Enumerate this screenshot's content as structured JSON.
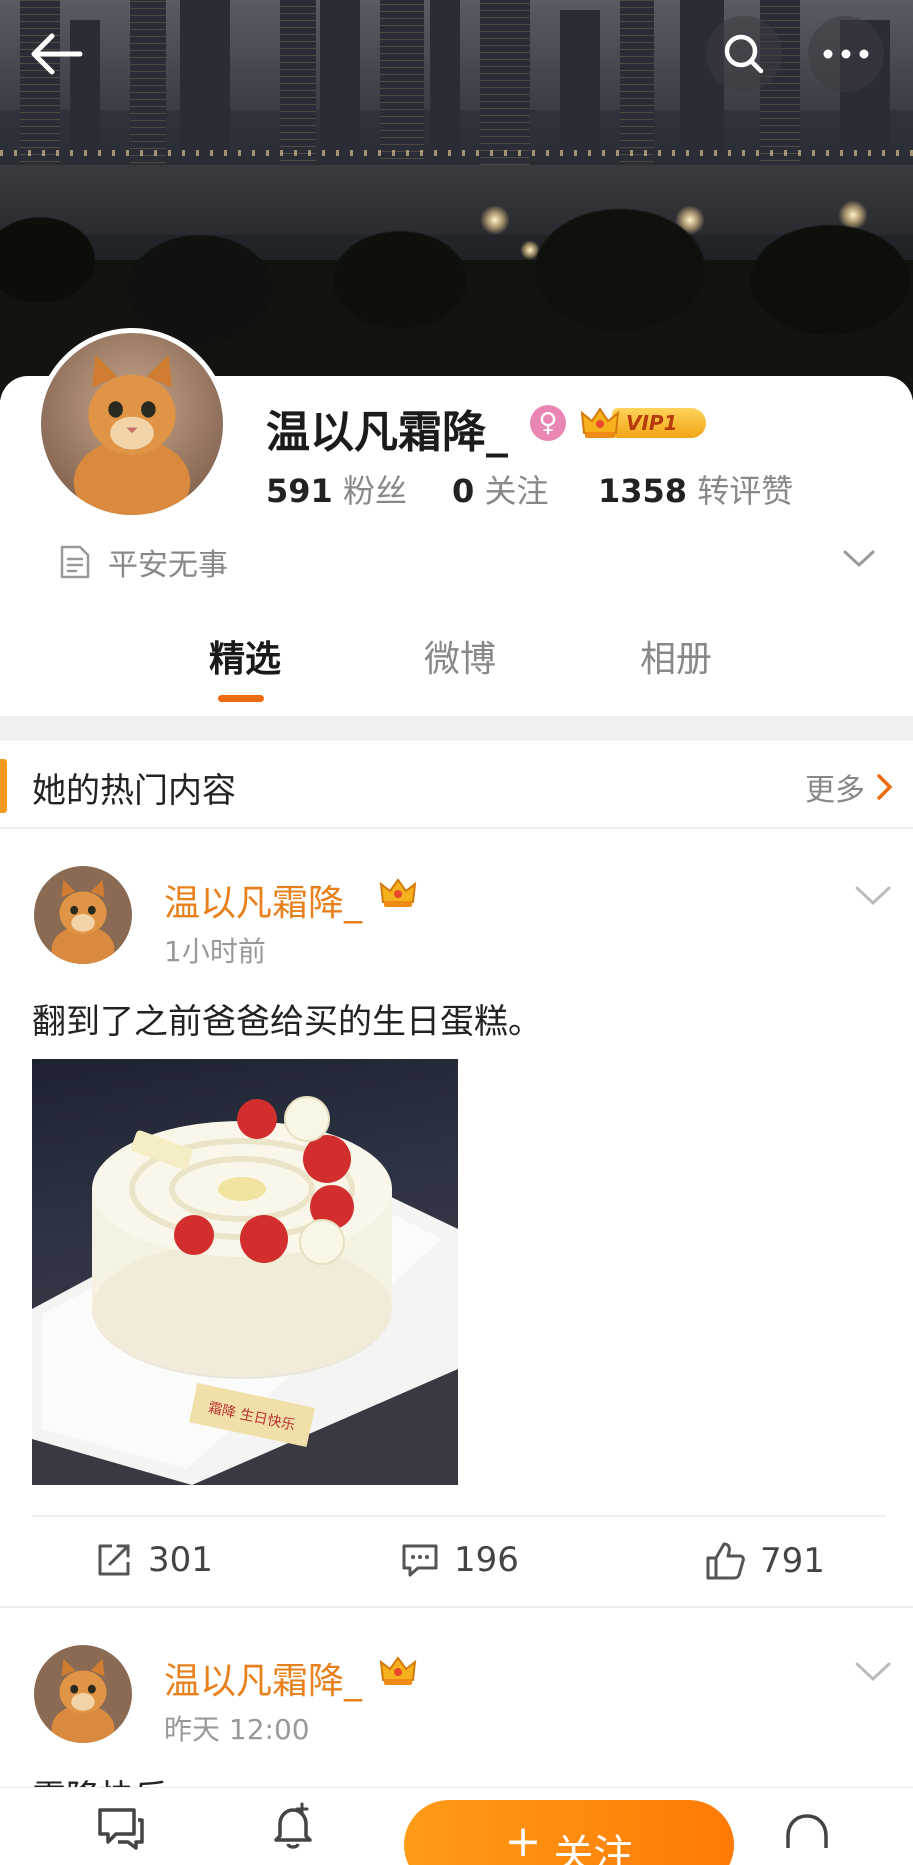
{
  "profile": {
    "name": "温以凡霜降_",
    "gender_symbol": "♀",
    "vip_label": "VIP1",
    "stats": [
      {
        "value": "591",
        "label": "粉丝"
      },
      {
        "value": "0",
        "label": "关注"
      },
      {
        "value": "1358",
        "label": "转评赞"
      }
    ],
    "bio": "平安无事"
  },
  "tabs": [
    {
      "label": "精选",
      "active": true
    },
    {
      "label": "微博",
      "active": false
    },
    {
      "label": "相册",
      "active": false
    }
  ],
  "hot_section": {
    "title": "她的热门内容",
    "more_label": "更多"
  },
  "posts": [
    {
      "author": "温以凡霜降_",
      "time": "1小时前",
      "text": "翻到了之前爸爸给买的生日蛋糕。",
      "cake_card_text": "霜降  生日快乐",
      "reposts": "301",
      "comments": "196",
      "likes": "791"
    },
    {
      "author": "温以凡霜降_",
      "time": "昨天 12:00",
      "text": "霜降快乐"
    }
  ],
  "bottom_bar": {
    "follow_label": "关注"
  },
  "colors": {
    "accent_orange": "#f06a0f",
    "name_orange": "#e8801c",
    "follow_button": "#ff8a0c"
  }
}
